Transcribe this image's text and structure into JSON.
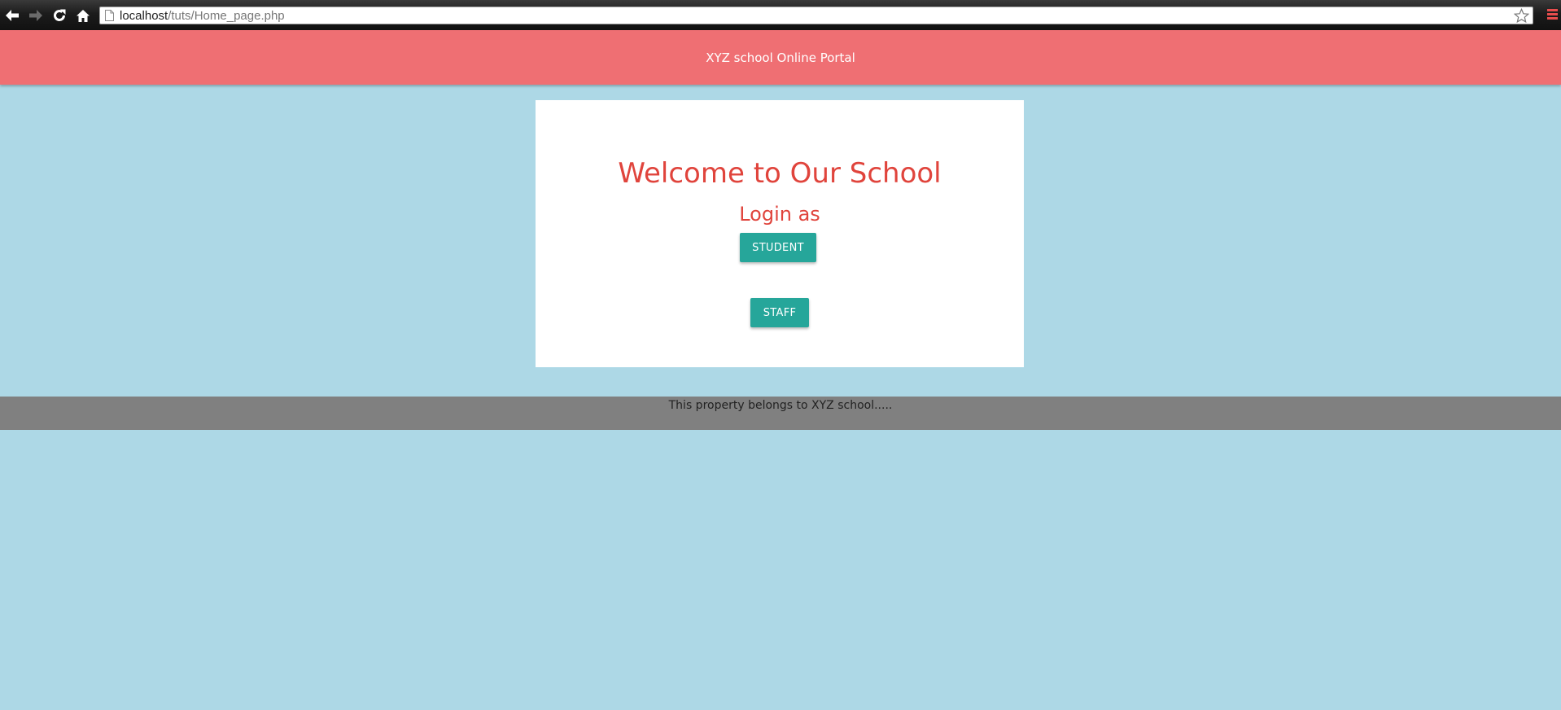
{
  "browser": {
    "back_icon": "back-arrow-icon",
    "forward_icon": "forward-arrow-icon",
    "reload_icon": "reload-icon",
    "home_icon": "home-icon",
    "url_host": "localhost",
    "url_path": "/tuts/Home_page.php",
    "bookmark_icon": "star-icon",
    "menu_icon": "hamburger-menu-icon"
  },
  "header": {
    "title": "XYZ school Online Portal"
  },
  "card": {
    "heading": "Welcome to Our School",
    "subheading": "Login as",
    "student_button": "STUDENT",
    "staff_button": "STAFF"
  },
  "footer": {
    "text": "This property belongs to XYZ school....."
  },
  "colors": {
    "header_bg": "#ef6f73",
    "page_bg": "#add8e6",
    "heading_text": "#e0443c",
    "button_bg": "#26a69a",
    "footer_bg": "#808080"
  }
}
